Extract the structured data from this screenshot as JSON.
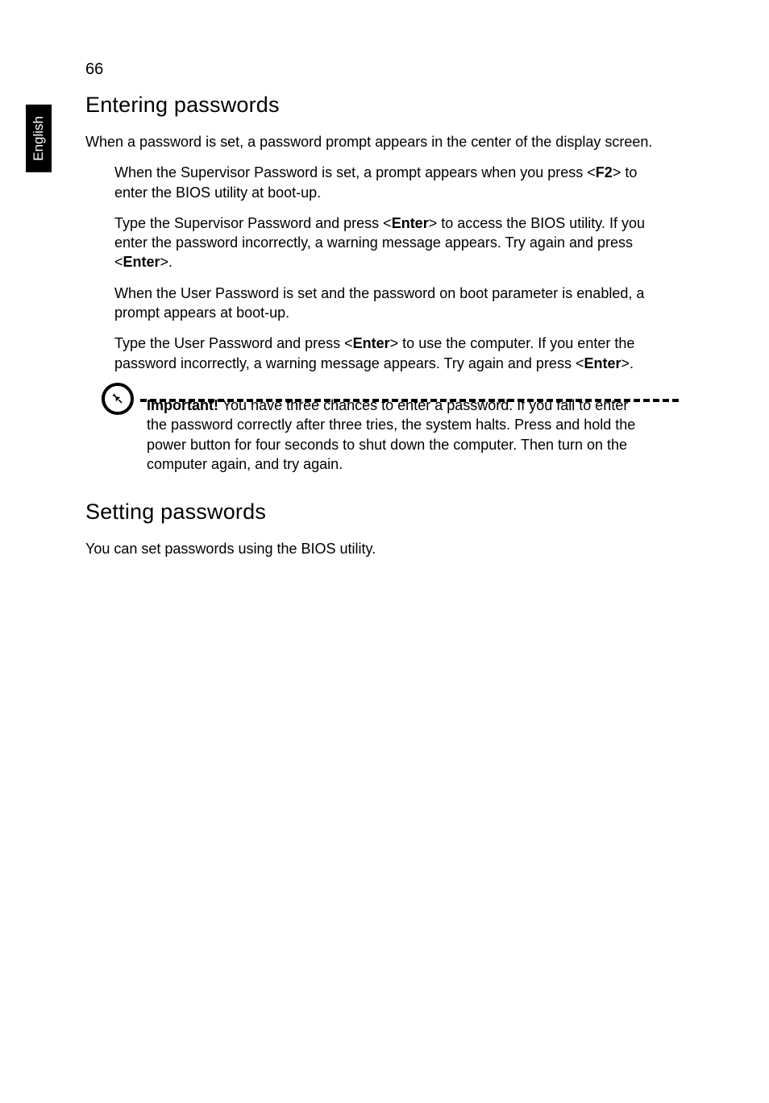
{
  "pageNumber": "66",
  "languageTab": "English",
  "section1": {
    "heading": "Entering passwords",
    "intro": "When a password is set, a password prompt appears in the center of the display screen.",
    "items": {
      "i0": {
        "pre": "When the Supervisor Password is set, a prompt appears when you press <",
        "k1": "F2",
        "post1": "> to enter the BIOS utility at boot-up."
      },
      "i1": {
        "pre": "Type the Supervisor Password and press <",
        "k1": "Enter",
        "mid1": "> to access the BIOS utility. If you enter the password incorrectly, a warning message appears. Try again and press <",
        "k2": "Enter",
        "post1": ">."
      },
      "i2": {
        "pre": "When the User Password is set and the password on boot parameter is enabled, a prompt appears at boot-up."
      },
      "i3": {
        "pre": "Type the User Password and press <",
        "k1": "Enter",
        "mid1": "> to use the computer. If you enter the password incorrectly, a warning message appears. Try again and press <",
        "k2": "Enter",
        "post1": ">."
      }
    },
    "note": {
      "bold": "Important!",
      "text": " You have three chances to enter a password. If you fail to enter the password correctly after three tries, the system halts. Press and hold the power button for four seconds to shut down the computer. Then turn on the computer again, and try again."
    }
  },
  "section2": {
    "heading": "Setting passwords",
    "body": "You can set passwords using the BIOS utility."
  }
}
